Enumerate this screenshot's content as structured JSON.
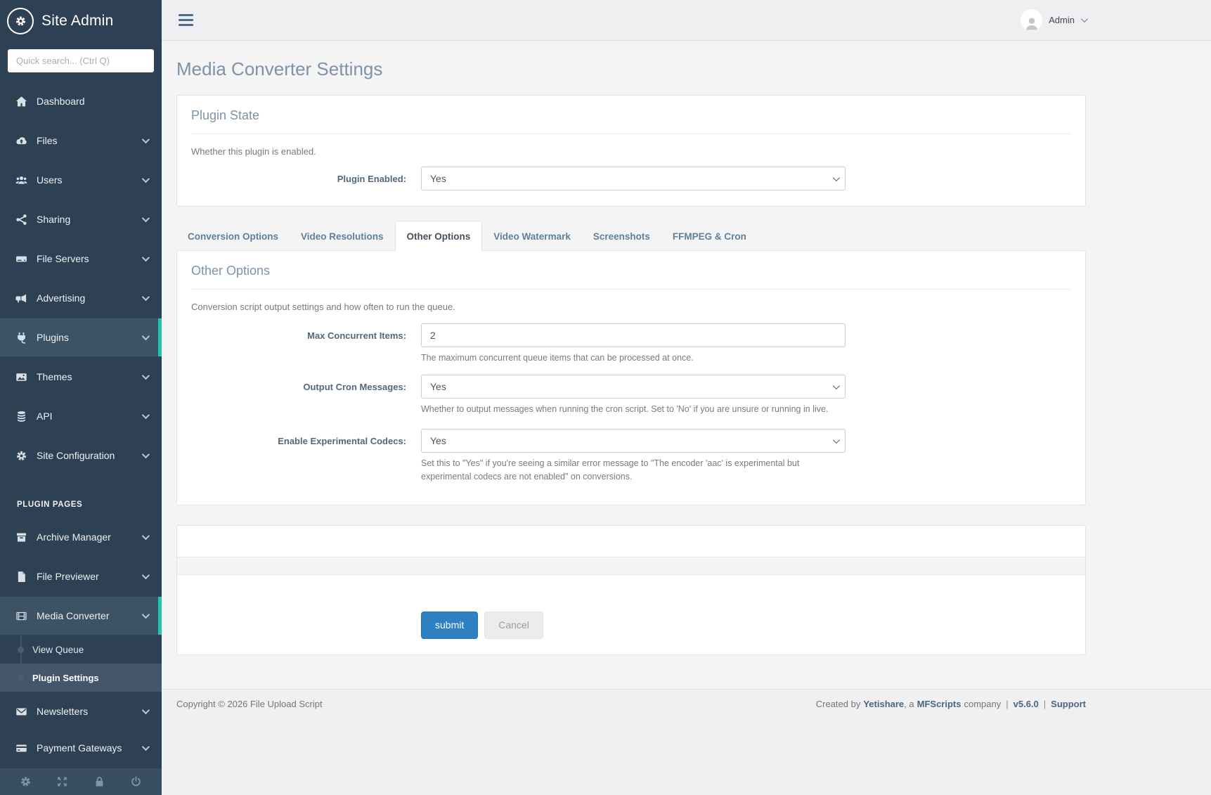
{
  "brand": {
    "title": "Site Admin"
  },
  "search": {
    "placeholder": "Quick search... (Ctrl Q)"
  },
  "topbar": {
    "user_name": "Admin"
  },
  "page_title": "Media Converter Settings",
  "sidebar": {
    "items": [
      {
        "label": "Dashboard",
        "icon": "home-icon"
      },
      {
        "label": "Files",
        "icon": "cloud-upload-icon"
      },
      {
        "label": "Users",
        "icon": "users-icon"
      },
      {
        "label": "Sharing",
        "icon": "share-icon"
      },
      {
        "label": "File Servers",
        "icon": "hdd-icon"
      },
      {
        "label": "Advertising",
        "icon": "bullhorn-icon"
      },
      {
        "label": "Plugins",
        "icon": "plug-icon",
        "active": true
      },
      {
        "label": "Themes",
        "icon": "image-icon"
      },
      {
        "label": "API",
        "icon": "database-icon"
      },
      {
        "label": "Site Configuration",
        "icon": "gear-icon"
      }
    ],
    "section_label": "PLUGIN PAGES",
    "plugin_items": [
      {
        "label": "Archive Manager",
        "icon": "archive-icon"
      },
      {
        "label": "File Previewer",
        "icon": "file-icon"
      },
      {
        "label": "Media Converter",
        "icon": "film-icon",
        "active": true,
        "expanded": true
      }
    ],
    "submenu": [
      {
        "label": "View Queue"
      },
      {
        "label": "Plugin Settings",
        "active": true
      }
    ],
    "bottom_items": [
      {
        "label": "Newsletters",
        "icon": "envelope-icon"
      },
      {
        "label": "Payment Gateways",
        "icon": "credit-card-icon"
      }
    ],
    "footer_icons": [
      "gear-icon",
      "expand-icon",
      "lock-icon",
      "power-icon"
    ]
  },
  "panels": {
    "plugin_state": {
      "heading": "Plugin State",
      "description": "Whether this plugin is enabled.",
      "plugin_enabled_label": "Plugin Enabled:",
      "plugin_enabled_value": "Yes"
    },
    "other_options": {
      "heading": "Other Options",
      "description": "Conversion script output settings and how often to run the queue.",
      "fields": [
        {
          "label": "Max Concurrent Items:",
          "type": "input",
          "value": "2",
          "help": "The maximum concurrent queue items that can be processed at once."
        },
        {
          "label": "Output Cron Messages:",
          "type": "select",
          "value": "Yes",
          "help": "Whether to output messages when running the cron script. Set to 'No' if you are unsure or running in live."
        },
        {
          "label": "Enable Experimental Codecs:",
          "type": "select",
          "value": "Yes",
          "help": "Set this to \"Yes\" if you're seeing a similar error message to \"The encoder 'aac' is experimental but experimental codecs are not enabled\" on conversions."
        }
      ]
    }
  },
  "tabs": [
    {
      "label": "Conversion Options"
    },
    {
      "label": "Video Resolutions"
    },
    {
      "label": "Other Options",
      "active": true
    },
    {
      "label": "Video Watermark"
    },
    {
      "label": "Screenshots"
    },
    {
      "label": "FFMPEG & Cron"
    }
  ],
  "buttons": {
    "submit": "submit",
    "cancel": "Cancel"
  },
  "footer": {
    "copyright": "Copyright © 2026 File Upload Script",
    "created_prefix": "Created by",
    "yetishare": "Yetishare",
    "company_mid": ", a",
    "mfscripts": "MFScripts",
    "company_suffix": "company",
    "separator": "|",
    "version": "v5.6.0",
    "support": "Support"
  },
  "colors": {
    "accent_teal": "#1fc8a8",
    "primary_blue": "#2f80c3",
    "sidebar_bg": "#2e4053",
    "heading_blue": "#7e92a8"
  }
}
